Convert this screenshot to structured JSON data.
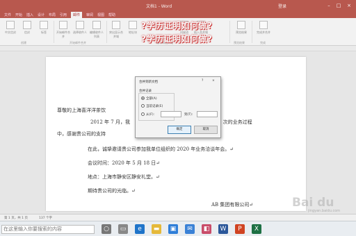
{
  "window": {
    "title": "文档1 - Word",
    "user": "登录"
  },
  "ribbon_tabs": [
    "文件",
    "开始",
    "插入",
    "设计",
    "布局",
    "引用",
    "邮件",
    "审阅",
    "视图",
    "帮助"
  ],
  "ribbon_tab_active_index": 6,
  "ribbon_groups": [
    "创建",
    "开始邮件合并",
    "编写和插入域",
    "预览结果",
    "完成"
  ],
  "ribbon_buttons": [
    {
      "icon": "envelope-icon",
      "label": "中文信封"
    },
    {
      "icon": "envelope-icon",
      "label": "信封"
    },
    {
      "icon": "label-icon",
      "label": "标签"
    },
    {
      "icon": "mail-merge-icon",
      "label": "开始邮件合并"
    },
    {
      "icon": "recipients-icon",
      "label": "选择收件人"
    },
    {
      "icon": "edit-list-icon",
      "label": "编辑收件人列表"
    },
    {
      "icon": "highlight-icon",
      "label": "突出显示合并域"
    },
    {
      "icon": "address-icon",
      "label": "地址块"
    },
    {
      "icon": "greeting-icon",
      "label": "问候语"
    },
    {
      "icon": "insert-field-icon",
      "label": "插入合并域"
    },
    {
      "icon": "preview-icon",
      "label": "预览结果"
    },
    {
      "icon": "finish-icon",
      "label": "完成并合并"
    }
  ],
  "overlay_caption": "?学历证明如何做?",
  "document": {
    "lines": [
      "尊敬的上海喜洋洋茶饮",
      "2012 年 7 月，我",
      "0 次的业务过程",
      "中，感谢贵公司的支持",
      "在此，诚挚邀请贵公司参加我单位组织的 2020 年业务洽谈年会。↵",
      "会议时间：2020 年 5 月 18 日↵",
      "地点：上海市静安区静安礼堂。↵",
      "期待贵公司的光临。↵",
      "AB 集团有限公司↵"
    ]
  },
  "dialog": {
    "title": "合并到新文档",
    "help": "?",
    "close": "×",
    "section_label": "合并记录",
    "options": [
      {
        "label": "全部(A)",
        "selected": true
      },
      {
        "label": "当前记录(E)",
        "selected": false
      },
      {
        "label": "从(F):",
        "selected": false
      }
    ],
    "to_label": "到(T):",
    "from_value": "",
    "to_value": "",
    "ok_label": "确定",
    "cancel_label": "取消"
  },
  "statusbar": {
    "page_info": "第 1 页，共 1 页",
    "word_count": "137 个字"
  },
  "taskbar": {
    "search_placeholder": "在这里输入你要搜索的内容",
    "apps": [
      "cortana-icon",
      "task-view-icon",
      "edge-icon",
      "file-explorer-icon",
      "store-icon",
      "mail-icon",
      "photos-icon",
      "word-icon",
      "powerpoint-icon",
      "excel-icon"
    ]
  },
  "watermark": {
    "text": "Bai du",
    "sub": "jingyan.baidu.com"
  },
  "colors": {
    "title_bar": "#b8584e",
    "ribbon_bg": "#f2f2f2",
    "caption": "#f7f7f7",
    "caption_glow": "#cc3333"
  }
}
